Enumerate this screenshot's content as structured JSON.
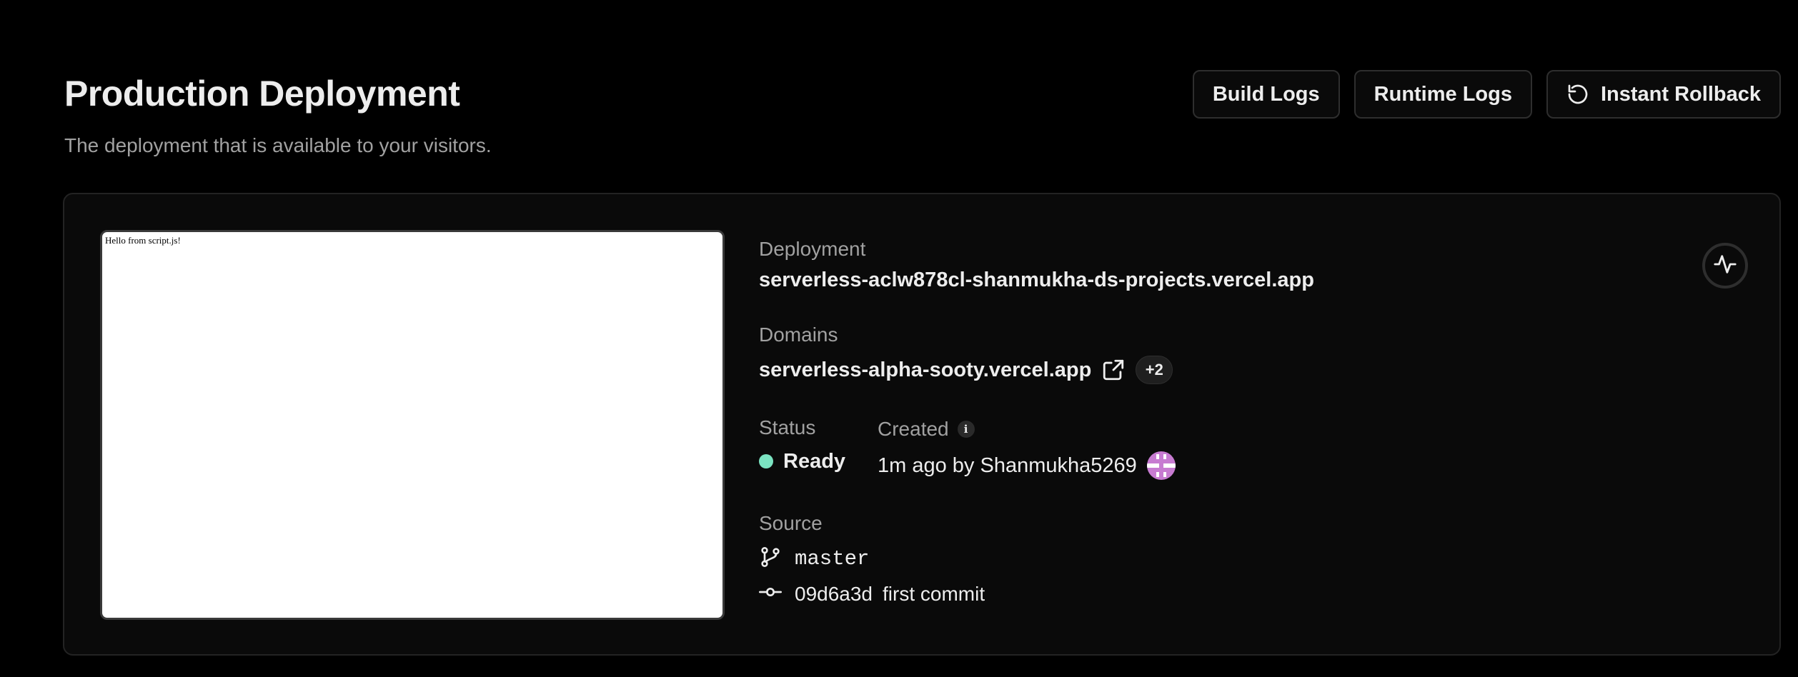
{
  "header": {
    "title": "Production Deployment",
    "subtitle": "The deployment that is available to your visitors."
  },
  "actions": {
    "build_logs": "Build Logs",
    "runtime_logs": "Runtime Logs",
    "instant_rollback": "Instant Rollback"
  },
  "preview": {
    "text": "Hello from script.js!"
  },
  "deployment": {
    "label": "Deployment",
    "url": "serverless-aclw878cl-shanmukha-ds-projects.vercel.app"
  },
  "domains": {
    "label": "Domains",
    "primary": "serverless-alpha-sooty.vercel.app",
    "extra_count": "+2"
  },
  "status": {
    "label": "Status",
    "value": "Ready",
    "color": "#7be3c1"
  },
  "created": {
    "label": "Created",
    "info_glyph": "i",
    "value": "1m ago by Shanmukha5269"
  },
  "source": {
    "label": "Source",
    "branch": "master",
    "commit_hash": "09d6a3d",
    "commit_message": "first commit"
  },
  "icons": {
    "rollback": "rollback-icon",
    "external_link": "external-link-icon",
    "branch": "git-branch-icon",
    "commit": "git-commit-icon",
    "activity": "activity-icon"
  },
  "colors": {
    "background": "#000000",
    "card": "#0a0a0a",
    "border": "#2e2e2e",
    "text": "#ededed",
    "muted": "#a1a1a1",
    "avatar": "#c77bd1"
  }
}
